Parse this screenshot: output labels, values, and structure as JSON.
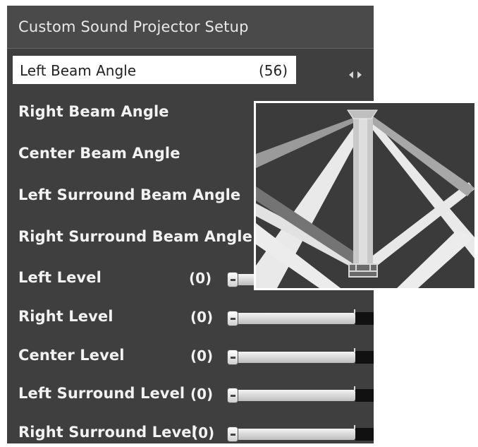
{
  "panel": {
    "title": "Custom Sound Projector Setup"
  },
  "rows": [
    {
      "label": "Left Beam Angle",
      "value": "(56)",
      "selected": true,
      "arrows": "◂▸"
    },
    {
      "label": "Right Beam Angle"
    },
    {
      "label": "Center Beam Angle"
    },
    {
      "label": "Left Surround Beam Angle"
    },
    {
      "label": "Right Surround Beam Angle"
    },
    {
      "label": "Left Level",
      "value": "(0)",
      "level": 0
    },
    {
      "label": "Right Level",
      "value": "(0)",
      "level": 0
    },
    {
      "label": "Center Level",
      "value": "(0)",
      "level": 0
    },
    {
      "label": "Left Surround Level",
      "value": "(0)",
      "level": 0
    },
    {
      "label": "Right Surround Level",
      "value": "(0)",
      "level": 0
    }
  ],
  "colors": {
    "panel_bg": "#3f3f3f",
    "text": "#f2f2f2",
    "beam_light": "#e9e9e9",
    "beam_mid": "#9a9a9a",
    "beam_dark": "#747474"
  },
  "icons": {
    "value_arrows": "left-right-arrows-icon",
    "speaker": "speaker-icon",
    "listener": "listener-icon"
  }
}
